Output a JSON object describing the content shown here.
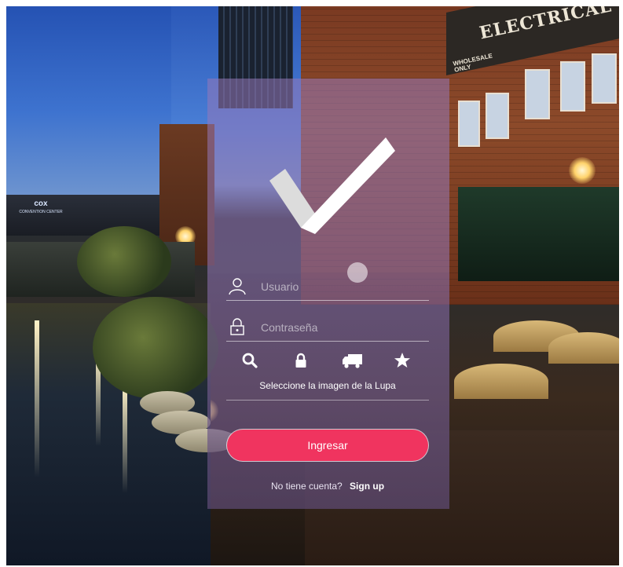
{
  "background": {
    "convention_sign": "cox",
    "convention_sign_sub": "CONVENTION CENTER",
    "building_sign": "ELECTRICAL FIXTU",
    "building_sign_small": "WHOLESALE ONLY"
  },
  "login": {
    "logo_icon": "checkmark-icon",
    "username_placeholder": "Usuario",
    "username_icon": "user-icon",
    "password_placeholder": "Contraseña",
    "password_icon": "lock-outline-icon",
    "image_options": [
      {
        "icon": "search-icon"
      },
      {
        "icon": "lock-icon"
      },
      {
        "icon": "truck-icon"
      },
      {
        "icon": "star-icon"
      }
    ],
    "image_hint": "Seleccione la imagen de la Lupa",
    "submit_label": "Ingresar",
    "no_account_text": "No tiene cuenta?",
    "signup_link": "Sign up"
  },
  "colors": {
    "primary_button": "#f0345f",
    "panel_overlay": "#9678b9"
  }
}
